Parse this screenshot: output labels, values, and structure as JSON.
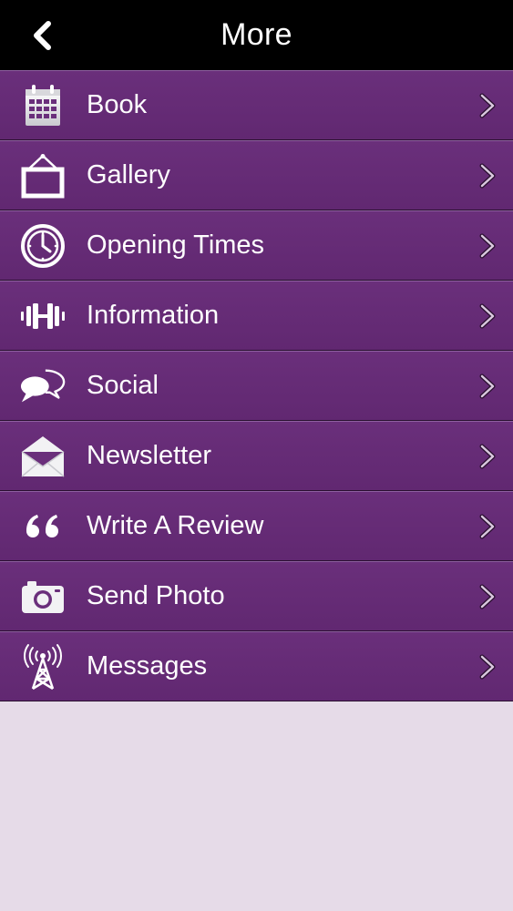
{
  "header": {
    "title": "More",
    "back_icon": "chevron-left-icon"
  },
  "menu": [
    {
      "label": "Book",
      "icon": "calendar-icon"
    },
    {
      "label": "Gallery",
      "icon": "picture-frame-icon"
    },
    {
      "label": "Opening Times",
      "icon": "clock-icon"
    },
    {
      "label": "Information",
      "icon": "dumbbell-icon"
    },
    {
      "label": "Social",
      "icon": "speech-bubbles-icon"
    },
    {
      "label": "Newsletter",
      "icon": "envelope-icon"
    },
    {
      "label": "Write A Review",
      "icon": "quote-icon"
    },
    {
      "label": "Send Photo",
      "icon": "camera-icon"
    },
    {
      "label": "Messages",
      "icon": "broadcast-tower-icon"
    }
  ],
  "colors": {
    "header": "#000000",
    "row": "#632a73",
    "background": "#e6dbe8",
    "text": "#ffffff"
  }
}
